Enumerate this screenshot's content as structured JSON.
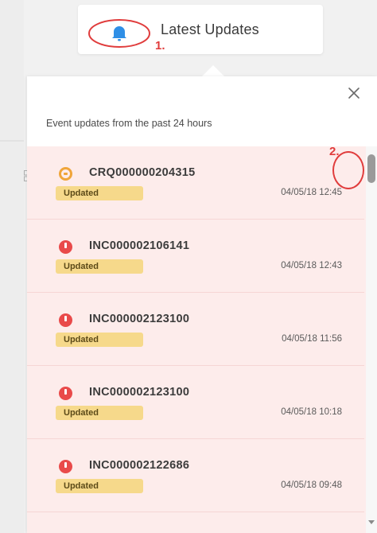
{
  "header": {
    "title": "Latest Updates",
    "annotation_1": "1.",
    "annotation_2": "2."
  },
  "panel": {
    "subtitle": "Event updates from the past 24 hours"
  },
  "colors": {
    "incident": "#e94a4a",
    "change": "#f0a53a",
    "badge": "#f6d98b",
    "list_bg": "#fdeceb",
    "annotation": "#e03c3c",
    "bell": "#2f8fe6"
  },
  "icons": {
    "bell": "bell-icon",
    "close": "close-icon",
    "grid": "grid-icon"
  },
  "items": [
    {
      "type": "change",
      "icon": "change-status-icon",
      "number": "CRQ000000204315",
      "badge": "Updated",
      "time": "04/05/18 12:45"
    },
    {
      "type": "incident",
      "icon": "incident-status-icon",
      "number": "INC000002106141",
      "badge": "Updated",
      "time": "04/05/18 12:43"
    },
    {
      "type": "incident",
      "icon": "incident-status-icon",
      "number": "INC000002123100",
      "badge": "Updated",
      "time": "04/05/18 11:56"
    },
    {
      "type": "incident",
      "icon": "incident-status-icon",
      "number": "INC000002123100",
      "badge": "Updated",
      "time": "04/05/18 10:18"
    },
    {
      "type": "incident",
      "icon": "incident-status-icon",
      "number": "INC000002122686",
      "badge": "Updated",
      "time": "04/05/18 09:48"
    }
  ]
}
